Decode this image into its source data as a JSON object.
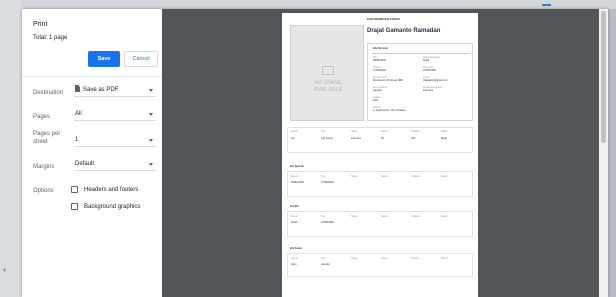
{
  "header": {
    "title": "Print",
    "total": "Total: 1 page"
  },
  "buttons": {
    "save": "Save",
    "cancel": "Cancel"
  },
  "settings": {
    "destination": {
      "label": "Destination",
      "value": "Save as PDF"
    },
    "pages": {
      "label": "Pages",
      "value": "All"
    },
    "pages_per_sheet": {
      "label_line1": "Pages per",
      "label_line2": "sheet",
      "value": "1"
    },
    "margins": {
      "label": "Margins",
      "value": "Default"
    },
    "options": {
      "label": "Options",
      "items": [
        {
          "label": "Headers and footers",
          "checked": false
        },
        {
          "label": "Background graphics",
          "checked": false
        }
      ]
    }
  },
  "preview": {
    "heading": "DATA RESERVASI KAMAR",
    "name": "Drajat Gamanto Ramadan",
    "photo_placeholder": {
      "line1": "NO IMAGE",
      "line2": "AVAILABLE"
    },
    "card_title": "Info Personal",
    "fields": [
      {
        "label": "NIK",
        "value": "3508125609"
      },
      {
        "label": "Nama Panggilan",
        "value": "Drajat"
      },
      {
        "label": "Telepon",
        "value": "7136930903"
      },
      {
        "label": "Kode Pos",
        "value": "1234567890"
      },
      {
        "label": "Tempat Lahir",
        "value": "Bondowoso, 28 Januari 1998"
      },
      {
        "label": "Email",
        "value": "drajatganto@gmail.com"
      },
      {
        "label": "Jenis Kelamin",
        "value": "Laki-laki"
      },
      {
        "label": "Kewarganegaraan",
        "value": "Indonesia"
      },
      {
        "label": "Agama",
        "value": "Islam"
      },
      {
        "label": "Alamat",
        "value": "Jl. Sudirman No. 123, Surabaya"
      }
    ],
    "section_labels": [
      "Info Spesifik",
      "Info Diri",
      "Info Kamar"
    ],
    "table_rows": [
      {
        "cols": [
          "Kamar",
          "Tipe",
          "Harga",
          "Status",
          "Fasilitas",
          "Diskon"
        ]
      },
      {
        "cols": [
          "Dst",
          "Tipe Kamar",
          "Kode Pos",
          "Rp",
          "Tarif",
          "Bayar"
        ]
      }
    ]
  }
}
